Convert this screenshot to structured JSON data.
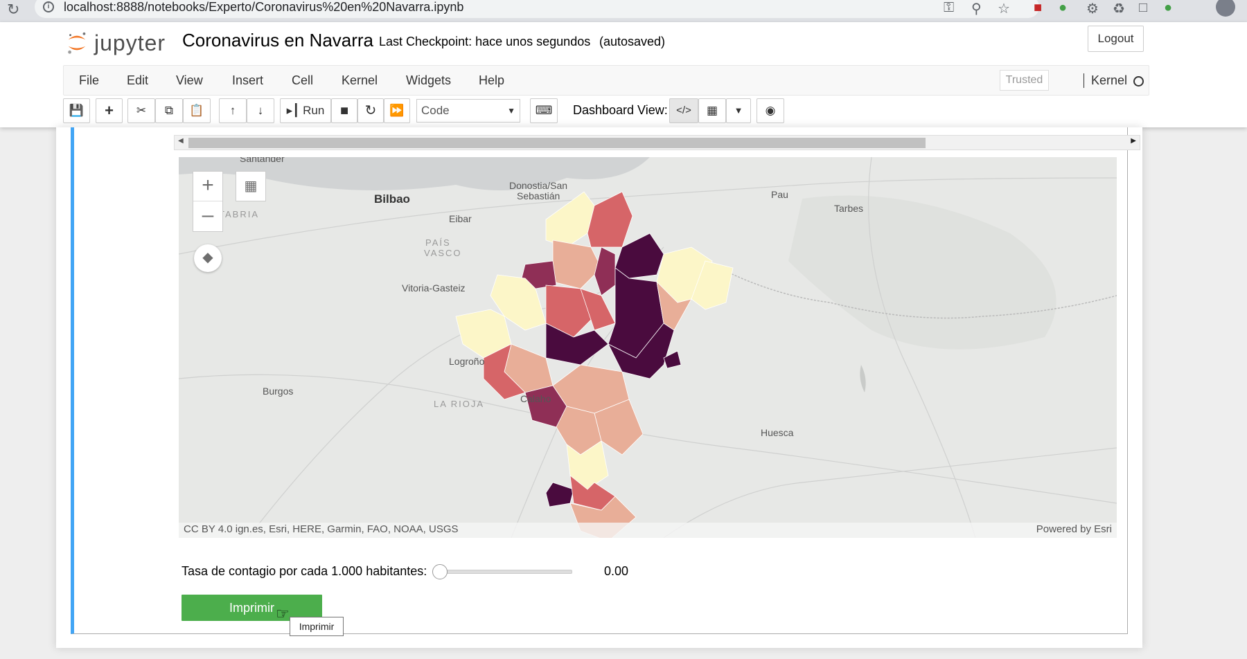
{
  "browser": {
    "url": "localhost:8888/notebooks/Experto/Coronavirus%20en%20Navarra.ipynb"
  },
  "header": {
    "logo_text": "jupyter",
    "notebook_name": "Coronavirus en Navarra",
    "checkpoint": "Last Checkpoint: hace unos segundos",
    "autosaved": "(autosaved)",
    "logout": "Logout"
  },
  "menubar": {
    "items": [
      "File",
      "Edit",
      "View",
      "Insert",
      "Cell",
      "Kernel",
      "Widgets",
      "Help"
    ],
    "trusted": "Trusted",
    "kernel_name": "Kernel"
  },
  "toolbar": {
    "run_label": "Run",
    "cell_type": "Code",
    "dashboard_label": "Dashboard View:"
  },
  "map": {
    "labels": {
      "santander": "Santander",
      "bilbao": "Bilbao",
      "donostia": "Donostia/San",
      "sebastian": "Sebastián",
      "eibar": "Eibar",
      "pais": "PAÍS",
      "vasco": "VASCO",
      "vitoria": "Vitoria-Gasteiz",
      "tabria": "TABRIA",
      "pau": "Pau",
      "tarbes": "Tarbes",
      "burgos": "Burgos",
      "logrono": "Logroño",
      "larioja": "LA RIOJA",
      "calahorra": "Calaho",
      "huesca": "Huesca"
    },
    "attribution_left": "CC BY 4.0 ign.es, Esri, HERE, Garmin, FAO, NOAA, USGS",
    "attribution_right": "Powered by Esri",
    "colors": {
      "level0": "#fcf6c8",
      "level1": "#e8ae98",
      "level2": "#d66568",
      "level3": "#8f2f56",
      "level4": "#4a0b3e"
    }
  },
  "widget": {
    "slider_label": "Tasa de contagio por cada 1.000 habitantes:",
    "slider_value": "0.00",
    "slider_fraction": 0,
    "button_label": "Imprimir",
    "tooltip": "Imprimir"
  }
}
